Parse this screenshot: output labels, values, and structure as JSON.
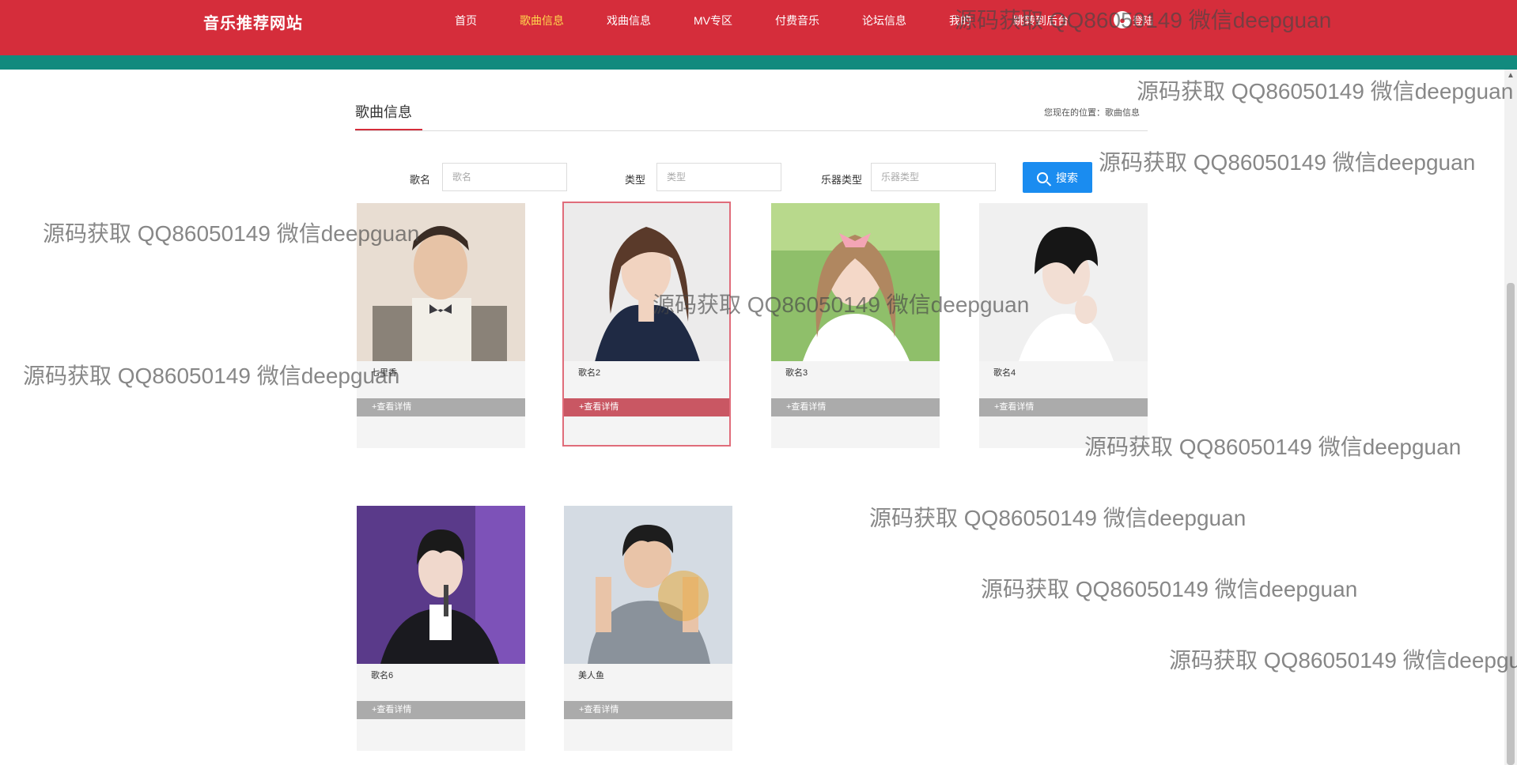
{
  "header": {
    "logo": "音乐推荐网站",
    "nav": [
      {
        "label": "首页",
        "active": false
      },
      {
        "label": "歌曲信息",
        "active": true
      },
      {
        "label": "戏曲信息",
        "active": false
      },
      {
        "label": "MV专区",
        "active": false
      },
      {
        "label": "付费音乐",
        "active": false
      },
      {
        "label": "论坛信息",
        "active": false
      },
      {
        "label": "我的",
        "active": false
      },
      {
        "label": "跳转到后台",
        "active": false
      }
    ],
    "user_label": "登陆"
  },
  "section": {
    "title": "歌曲信息",
    "breadcrumb": "您现在的位置：歌曲信息"
  },
  "search": {
    "fields": [
      {
        "label": "歌名",
        "placeholder": "歌名"
      },
      {
        "label": "类型",
        "placeholder": "类型"
      },
      {
        "label": "乐器类型",
        "placeholder": "乐器类型"
      }
    ],
    "button_label": "搜索"
  },
  "songs": [
    {
      "name": "七里香",
      "detail": "+查看详情",
      "highlighted": false
    },
    {
      "name": "歌名2",
      "detail": "+查看详情",
      "highlighted": true
    },
    {
      "name": "歌名3",
      "detail": "+查看详情",
      "highlighted": false
    },
    {
      "name": "歌名4",
      "detail": "+查看详情",
      "highlighted": false
    },
    {
      "name": "歌名6",
      "detail": "+查看详情",
      "highlighted": false
    },
    {
      "name": "美人鱼",
      "detail": "+查看详情",
      "highlighted": false
    }
  ],
  "watermark": "源码获取 QQ86050149 微信deepguan",
  "colors": {
    "header_red": "#d52d3b",
    "teal_band": "#118a7e",
    "active_nav": "#ffd84d",
    "search_button": "#1a8cf0",
    "detail_bar": "#ababab",
    "detail_bar_active": "#c95763"
  }
}
